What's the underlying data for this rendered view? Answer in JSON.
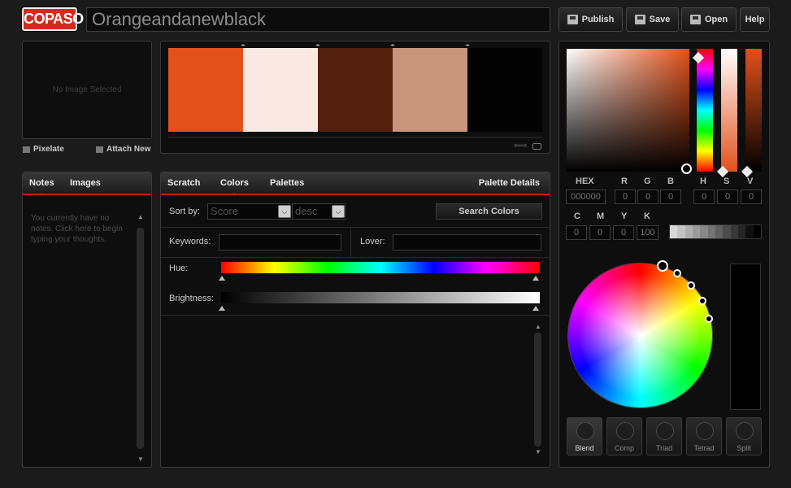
{
  "header": {
    "logo": "COPASO",
    "palette_title": "Orangeandanewblack",
    "buttons": {
      "publish": "Publish",
      "save": "Save",
      "open": "Open",
      "help": "Help"
    }
  },
  "image_panel": {
    "empty_text": "No Image Selected",
    "pixelate": "Pixelate",
    "attach": "Attach New"
  },
  "palette": {
    "colors": [
      "#e2511a",
      "#fce8e2",
      "#53200e",
      "#c9947c",
      "#030303"
    ]
  },
  "notes_panel": {
    "tabs": [
      "Notes",
      "Images"
    ],
    "active_tab": "Notes",
    "placeholder": "You currently have no notes. Click here to begin typing your thoughts."
  },
  "colors_panel": {
    "tabs": [
      "Scratch",
      "Colors",
      "Palettes"
    ],
    "active_tab": "Colors",
    "details_link": "Palette Details",
    "sort_label": "Sort by:",
    "sort_value": "Score",
    "order_value": "desc",
    "search_button": "Search Colors",
    "keywords_label": "Keywords:",
    "lover_label": "Lover:",
    "hue_label": "Hue:",
    "brightness_label": "Brightness:"
  },
  "picker": {
    "current_color": "#e2511a",
    "labels": {
      "hex": "HEX",
      "r": "R",
      "g": "G",
      "b": "B",
      "h": "H",
      "s": "S",
      "v": "V",
      "c": "C",
      "m": "M",
      "y": "Y",
      "k": "K"
    },
    "values": {
      "hex": "000000",
      "r": "0",
      "g": "0",
      "b": "0",
      "h": "0",
      "s": "0",
      "v": "0",
      "c": "0",
      "m": "0",
      "y": "0",
      "k": "100"
    },
    "modes": [
      "Blend",
      "Comp",
      "Triad",
      "Tetrad",
      "Split"
    ],
    "active_mode": "Blend"
  }
}
